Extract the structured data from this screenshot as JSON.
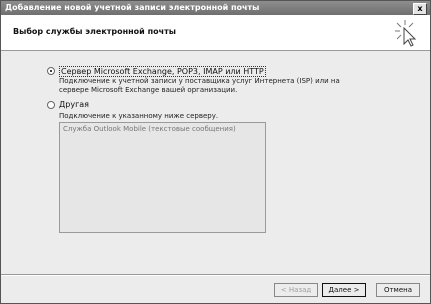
{
  "window": {
    "title": "Добавление новой учетной записи электронной почты",
    "close_glyph": "x"
  },
  "header": {
    "heading": "Выбор службы электронной почты",
    "icon": "wizard-cursor-icon"
  },
  "options": [
    {
      "label": "Сервер Microsoft Exchange, POP3, IMAP или HTTP",
      "selected": true,
      "description_line1": "Подключение к учетной записи у поставщика услуг Интернета (ISP) или на",
      "description_line2": "сервере Microsoft Exchange вашей организации."
    },
    {
      "label": "Другая",
      "selected": false,
      "description_line1": "Подключение к указанному ниже серверу."
    }
  ],
  "other_servers_list": {
    "items": [
      "Служба Outlook Mobile (текстовые сообщения)"
    ]
  },
  "buttons": {
    "back": "< Назад",
    "next": "Далее >",
    "cancel": "Отмена"
  }
}
